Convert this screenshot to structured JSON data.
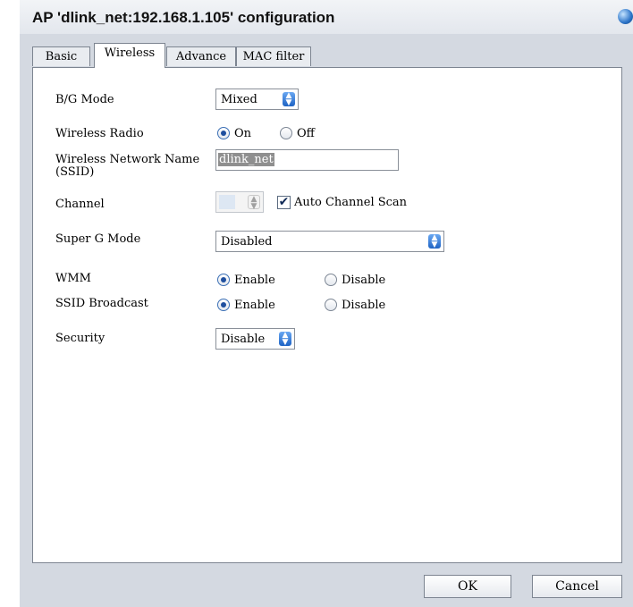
{
  "window": {
    "title": "AP 'dlink_net:192.168.1.105' configuration",
    "icon": "globe-icon"
  },
  "tabs": [
    {
      "label": "Basic",
      "active": false
    },
    {
      "label": "Wireless",
      "active": true
    },
    {
      "label": "Advance",
      "active": false
    },
    {
      "label": "MAC filter",
      "active": false
    }
  ],
  "form": {
    "bg_mode": {
      "label": "B/G Mode",
      "value": "Mixed"
    },
    "wireless_radio": {
      "label": "Wireless Radio",
      "options": [
        "On",
        "Off"
      ],
      "selected": "On"
    },
    "ssid": {
      "label_line1": "Wireless Network Name",
      "label_line2": "(SSID)",
      "value": "dlink_net"
    },
    "channel": {
      "label": "Channel",
      "value": "",
      "auto_scan_label": "Auto Channel Scan",
      "auto_scan_checked": true
    },
    "super_g": {
      "label": "Super G Mode",
      "value": "Disabled"
    },
    "wmm": {
      "label": "WMM",
      "options": [
        "Enable",
        "Disable"
      ],
      "selected": "Enable"
    },
    "ssid_broadcast": {
      "label": "SSID Broadcast",
      "options": [
        "Enable",
        "Disable"
      ],
      "selected": "Enable"
    },
    "security": {
      "label": "Security",
      "value": "Disable"
    }
  },
  "buttons": {
    "ok": "OK",
    "cancel": "Cancel"
  },
  "colors": {
    "window_bg": "#d4d9e1",
    "panel_bg": "#ffffff",
    "accent_blue": "#1e63c4",
    "selection_gray": "#8f8f8f"
  }
}
